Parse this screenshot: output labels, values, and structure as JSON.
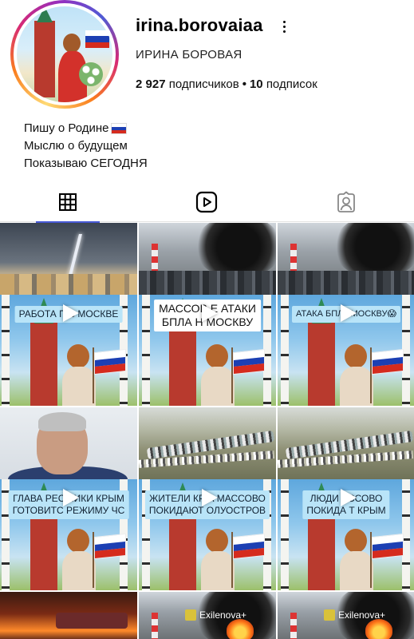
{
  "profile": {
    "username": "irina.borovaiaa",
    "full_name": "ИРИНА БОРОВАЯ",
    "followers_count": "2 927",
    "followers_label": "подписчиков",
    "separator": "•",
    "following_count": "10",
    "following_label": "подписок",
    "bio": [
      "Пишу о Родине",
      "Мыслю о будущем",
      "Показываю СЕГОДНЯ"
    ],
    "bio_flag_icon": "russian-flag"
  },
  "tabs": [
    {
      "icon": "grid-icon",
      "active": true
    },
    {
      "icon": "reels-icon",
      "active": false
    },
    {
      "icon": "tagged-icon",
      "active": false
    }
  ],
  "colors": {
    "accent": "#4759d6",
    "caption_bg": "#b9e4f8",
    "flag_white": "#ffffff",
    "flag_blue": "#1c3fb3",
    "flag_red": "#d52b1e"
  },
  "posts": [
    {
      "caption": "РАБОТА П   В МОСКВЕ"
    },
    {
      "caption_line1": "МАССОВ   Е АТАКИ",
      "caption_line2": "БПЛА Н   МОСКВУ"
    },
    {
      "caption": "АТАКА БПЛ   . МОСКВУ😱"
    },
    {
      "caption_line1": "ГЛАВА РЕС   ЛИКИ КРЫМ",
      "caption_line2": "ГОТОВИТС   РЕЖИМУ ЧС"
    },
    {
      "caption_line1": "ЖИТЕЛИ КР   А МАССОВО",
      "caption_line2": "ПОКИДАЮТ   ОЛУОСТРОВ"
    },
    {
      "caption_line1": "ЛЮДИ   АССОВО",
      "caption_line2": "ПОКИДА   Т КРЫМ"
    },
    {
      "watermark": ""
    },
    {
      "watermark": "Exilenova+"
    },
    {
      "watermark": "Exilenova+"
    }
  ]
}
